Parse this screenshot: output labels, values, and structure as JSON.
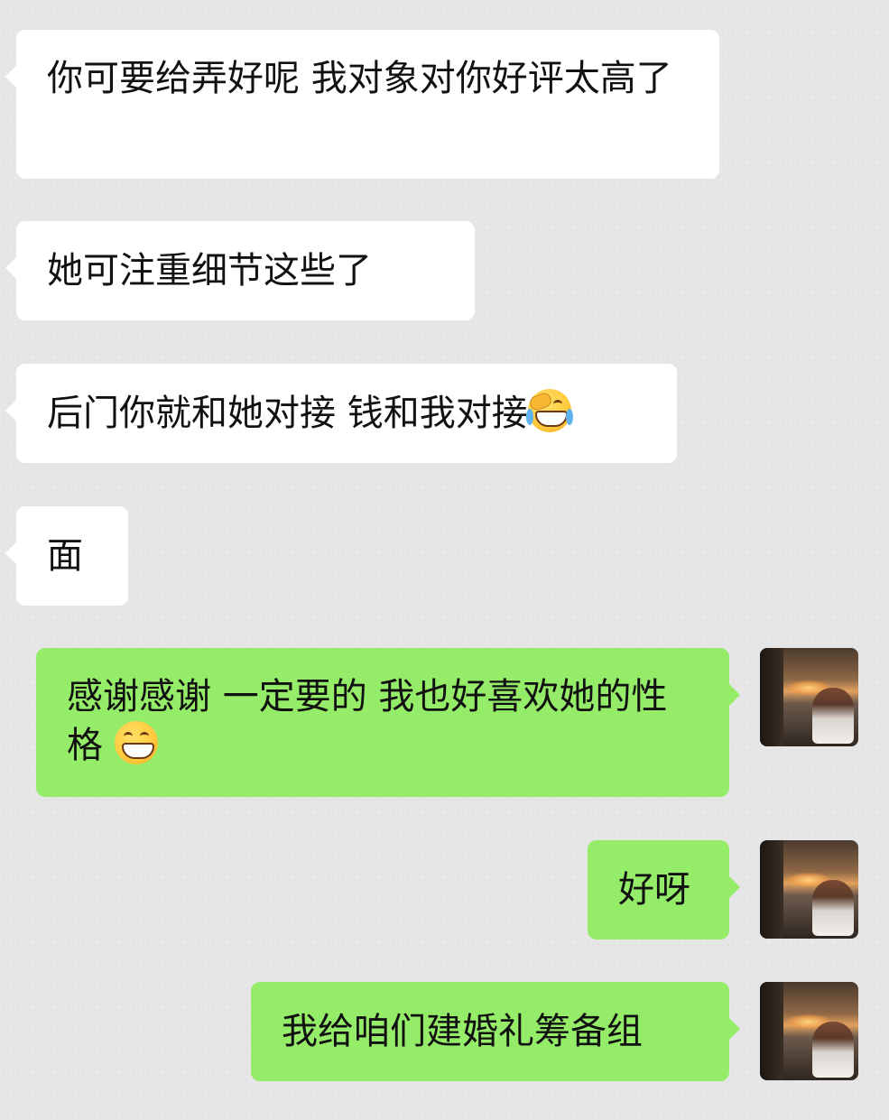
{
  "messages": [
    {
      "side": "received",
      "text": "你可要给弄好呢   我对象对你好评太高了"
    },
    {
      "side": "received",
      "text": "她可注重细节这些了"
    },
    {
      "side": "received",
      "text": "后门你就和她对接  钱和我对接",
      "emoji": "face-with-tears-of-joy"
    },
    {
      "side": "received",
      "text": "面"
    },
    {
      "side": "sent",
      "text": "感谢感谢 一定要的 我也好喜欢她的性格 ",
      "emoji": "grinning-face"
    },
    {
      "side": "sent",
      "text": "好呀"
    },
    {
      "side": "sent",
      "text": "我给咱们建婚礼筹备组"
    }
  ],
  "colors": {
    "background": "#e6e6e6",
    "received_bubble": "#ffffff",
    "sent_bubble": "#95ec69"
  }
}
